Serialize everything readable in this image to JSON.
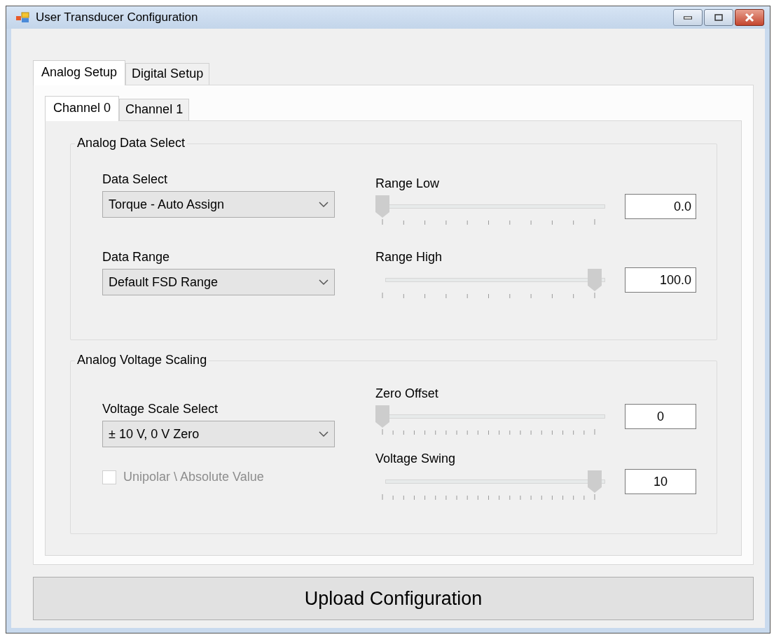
{
  "window": {
    "title": "User Transducer Configuration"
  },
  "tabs": [
    {
      "label": "Analog Setup",
      "selected": true
    },
    {
      "label": "Digital Setup",
      "selected": false
    }
  ],
  "channel_tabs": [
    {
      "label": "Channel 0",
      "selected": true
    },
    {
      "label": "Channel 1",
      "selected": false
    }
  ],
  "groups": [
    {
      "kind": "range",
      "title": "Analog Data Select",
      "selectors": [
        {
          "label": "Data Select",
          "value": "Torque - Auto Assign"
        },
        {
          "label": "Data Range",
          "value": "Default FSD Range"
        }
      ],
      "sliders": [
        {
          "label": "Range Low",
          "level": 0,
          "value": "0.0"
        },
        {
          "label": "Range High",
          "level": 1,
          "value": "100.0"
        }
      ]
    },
    {
      "kind": "scaling",
      "title": "Analog Voltage Scaling",
      "selectors": [
        {
          "label": "Voltage Scale Select",
          "value": "± 10 V, 0 V Zero"
        }
      ],
      "checkbox": {
        "label": "Unipolar \\ Absolute Value",
        "checked": false,
        "disabled": true
      },
      "sliders": [
        {
          "label": "Zero Offset",
          "level": 0,
          "value": "0"
        },
        {
          "label": "Voltage Swing",
          "level": 1,
          "value": "10"
        }
      ]
    }
  ],
  "upload_button": {
    "label": "Upload Configuration"
  }
}
